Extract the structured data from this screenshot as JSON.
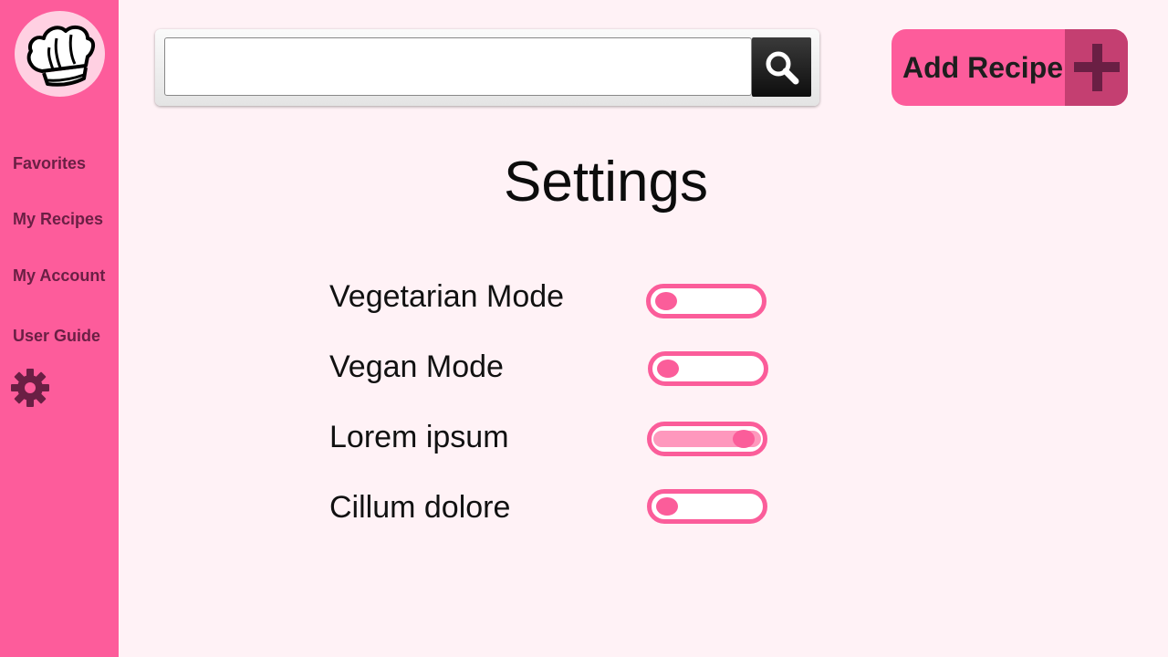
{
  "sidebar": {
    "logo_icon": "chef-hat-icon",
    "items": [
      {
        "label": "Favorites"
      },
      {
        "label": "My Recipes"
      },
      {
        "label": "My Account"
      },
      {
        "label": "User Guide"
      }
    ],
    "settings_icon": "gear-icon"
  },
  "search": {
    "value": "",
    "placeholder": "",
    "button_icon": "search-icon"
  },
  "add_recipe": {
    "label": "Add Recipe",
    "icon": "plus-icon"
  },
  "page": {
    "title": "Settings"
  },
  "settings": [
    {
      "label": "Vegetarian Mode",
      "enabled": false
    },
    {
      "label": "Vegan Mode",
      "enabled": false
    },
    {
      "label": "Lorem ipsum",
      "enabled": true
    },
    {
      "label": "Cillum dolore",
      "enabled": false
    }
  ],
  "colors": {
    "sidebar": "#fd5c9b",
    "background": "#fff2f6",
    "accent": "#fb5d9a",
    "accent_dark": "#c43f71",
    "nav_text": "#6a1f44"
  }
}
